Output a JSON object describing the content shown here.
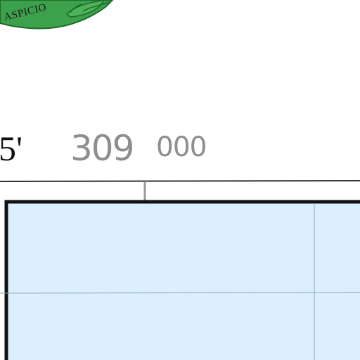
{
  "seal": {
    "text": "ASPICIO",
    "colors": {
      "green": "#3da04a",
      "dark_green": "#1e6b2a"
    }
  },
  "margin": {
    "longitude_label": "5'",
    "grid_easting_major": "309",
    "grid_easting_minor": "000"
  },
  "map": {
    "water_color": "#dcefff",
    "border_color": "#111111",
    "grid_line_color": "#8aa6b8",
    "tick_color": "#9a9a9a"
  }
}
